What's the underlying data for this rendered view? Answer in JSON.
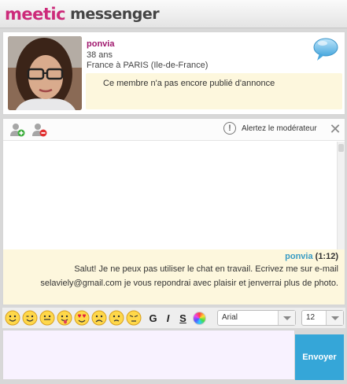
{
  "header": {
    "logo_brand": "meetic",
    "logo_rest": "messenger",
    "accent": "#cc2a7a"
  },
  "profile": {
    "name": "ponvia",
    "age": "38 ans",
    "location": "France à PARIS (Ile-de-France)",
    "annonce": "Ce membre n'a pas encore publié d'annonce",
    "name_color": "#a0186e"
  },
  "toolbar": {
    "add_contact_icon": "add-contact-icon",
    "block_contact_icon": "block-contact-icon",
    "report_label": "Alertez le modérateur",
    "close_icon": "close-icon"
  },
  "conversation": {
    "messages": [
      {
        "author": "ponvia",
        "time": "(1:12)",
        "text": "Salut! Je ne peux pas utiliser le chat en travail. Ecrivez me sur e-mail selaviely@gmail.com je vous repondrai avec plaisir et jenverrai plus de photo."
      }
    ],
    "author_color": "#3a9cc4",
    "bg": "#fdf7dd"
  },
  "composer": {
    "emojis": [
      "smile-emoji",
      "wink-emoji",
      "grin-emoji",
      "tongue-emoji",
      "love-emoji",
      "sad-emoji",
      "worried-emoji",
      "annoyed-emoji"
    ],
    "bold_label": "G",
    "italic_label": "I",
    "underline_label": "S",
    "font_value": "Arial",
    "size_value": "12",
    "send_label": "Envoyer",
    "send_color": "#35a6d8"
  }
}
